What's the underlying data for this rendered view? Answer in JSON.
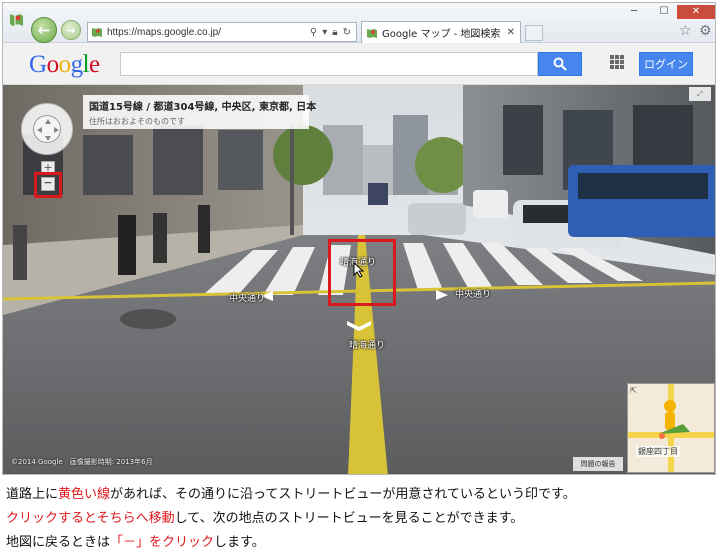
{
  "browser": {
    "url": "https://maps.google.co.jp/",
    "tab_title": "Google マップ - 地図検索",
    "close_label": "✕",
    "min_label": "─",
    "max_label": "☐",
    "win_close_label": "✕"
  },
  "google_header": {
    "logo": [
      "G",
      "o",
      "o",
      "g",
      "l",
      "e"
    ],
    "logo_colors": [
      "#3369e8",
      "#d50f25",
      "#eeb211",
      "#3369e8",
      "#009925",
      "#d50f25"
    ],
    "login_label": "ログイン"
  },
  "streetview": {
    "address_title": "国道15号線 / 都道304号線, 中央区, 東京都, 日本",
    "address_sub": "住所はおおよそのものです",
    "zoom_in_label": "+",
    "zoom_out_label": "−",
    "road_labels": {
      "harumi_top": "晴海通り",
      "chuo_left": "中央通り",
      "chuo_right": "中央通り",
      "harumi_bottom": "晴海通り"
    },
    "copyright": "©2014 Google　画像撮影時期: 2013年6月",
    "report_label": "問題の報告",
    "minimap_label": "銀座四丁目",
    "highlight_color": "#d9191c"
  },
  "caption": {
    "line1": [
      {
        "text": "道路上に",
        "red": false
      },
      {
        "text": "黄色い線",
        "red": true
      },
      {
        "text": "があれば、その通りに沿ってストリートビューが用意されているという印です。",
        "red": false
      }
    ],
    "line2": [
      {
        "text": "クリックするとそちらへ移動",
        "red": true
      },
      {
        "text": "して、次の地点のストリートビューを見ることができます。",
        "red": false
      }
    ],
    "line3": [
      {
        "text": "地図に戻るときは",
        "red": false
      },
      {
        "text": "「－」をクリック",
        "red": true
      },
      {
        "text": "します。",
        "red": false
      }
    ]
  }
}
